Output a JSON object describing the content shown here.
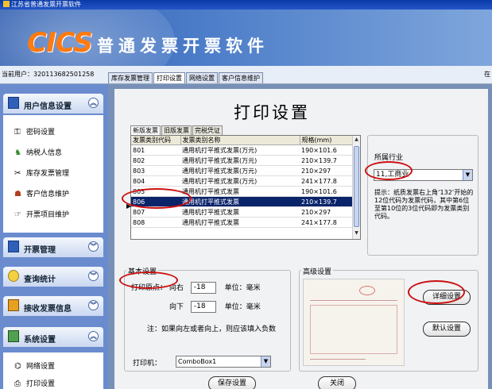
{
  "window": {
    "title": "江苏省普通发票开票软件"
  },
  "banner": {
    "logo": "CICS",
    "app_title": "普通发票开票软件"
  },
  "status": {
    "current_user": "当前用户：320113682501258",
    "edge_char": "在"
  },
  "top_tabs": [
    {
      "label": "库存发票管理"
    },
    {
      "label": "打印设置"
    },
    {
      "label": "网络设置"
    },
    {
      "label": "客户信息维护"
    }
  ],
  "sidebar": {
    "sections": [
      {
        "label": "用户信息设置",
        "chevron": "︽"
      },
      {
        "label": "开票管理",
        "chevron": "︾"
      },
      {
        "label": "查询统计",
        "chevron": "︾"
      },
      {
        "label": "接收发票信息",
        "chevron": "︾"
      },
      {
        "label": "系统设置",
        "chevron": "︽"
      }
    ],
    "items": [
      {
        "label": "密码设置",
        "icon": "key-icon"
      },
      {
        "label": "纳税人信息",
        "icon": "person-icon"
      },
      {
        "label": "库存发票管理",
        "icon": "tools-icon"
      },
      {
        "label": "客户信息维护",
        "icon": "customer-icon"
      },
      {
        "label": "开票项目维护",
        "icon": "item-icon"
      }
    ],
    "system_items": [
      {
        "label": "网络设置",
        "icon": "network-icon"
      },
      {
        "label": "打印设置",
        "icon": "printer-icon"
      }
    ]
  },
  "main": {
    "title": "打印设置",
    "subtabs": [
      {
        "label": "新版发票"
      },
      {
        "label": "旧版发票"
      },
      {
        "label": "完税凭证"
      }
    ],
    "table": {
      "headers": [
        "发票类别代码",
        "发票类别名称",
        "规格(mm)"
      ],
      "rows": [
        [
          "801",
          "通用机打平推式发票(万元)",
          "190×101.6"
        ],
        [
          "802",
          "通用机打平推式发票(万元)",
          "210×139.7"
        ],
        [
          "803",
          "通用机打平推式发票(万元)",
          "210×297"
        ],
        [
          "804",
          "通用机打平推式发票(万元)",
          "241×177.8"
        ],
        [
          "805",
          "通用机打平推式发票",
          "190×101.6"
        ],
        [
          "806",
          "通用机打平推式发票",
          "210×139.7"
        ],
        [
          "807",
          "通用机打平推式发票",
          "210×297"
        ],
        [
          "808",
          "通用机打平推式发票",
          "241×177.8"
        ]
      ],
      "selected_row": 5,
      "pointer": "▶"
    },
    "industry": {
      "label": "所属行业",
      "value": "11,工商业",
      "hint": "提示：纸质发票右上角‘132’开始的12位代码为发票代码，其中第6位至第10位的3位代码即为发票类别代码。"
    },
    "basic": {
      "legend": "基本设置",
      "origin_label": "打印原点：",
      "right_label": "向右",
      "right_value": "-18",
      "down_label": "向下",
      "down_value": "-18",
      "unit_label": "单位：毫米",
      "note": "注：如果向左或者向上，则应该填入负数",
      "printer_label": "打印机：",
      "printer_value": "ComboBox1"
    },
    "advanced": {
      "legend": "高级设置",
      "detail_button": "详细设置",
      "default_button": "默认设置"
    },
    "save_button": "保存设置",
    "close_button": "关闭"
  },
  "colors": {
    "highlight": "#0a246a",
    "annotation": "#cc1010",
    "logo": "#ff7a10"
  }
}
